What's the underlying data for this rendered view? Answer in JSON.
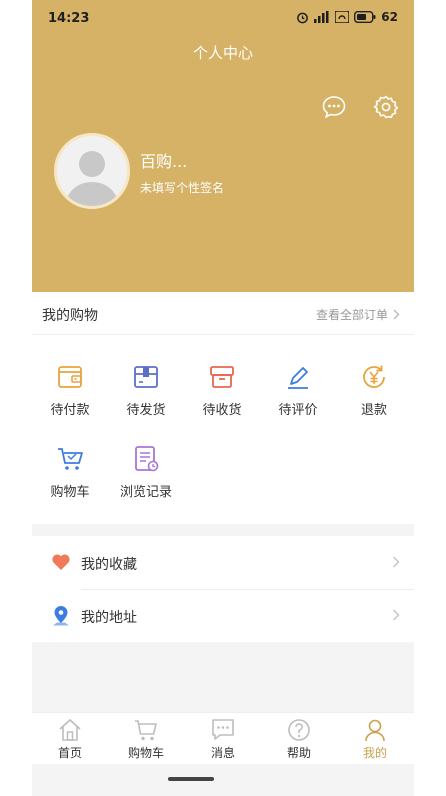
{
  "status_bar": {
    "time": "14:23",
    "battery": "62"
  },
  "header": {
    "title": "个人中心",
    "username": "百购...",
    "signature": "未填写个性签名"
  },
  "orders": {
    "title": "我的购物",
    "view_all": "查看全部订单",
    "items": [
      {
        "label": "待付款",
        "icon": "wallet-icon"
      },
      {
        "label": "待发货",
        "icon": "package-icon"
      },
      {
        "label": "待收货",
        "icon": "box-icon"
      },
      {
        "label": "待评价",
        "icon": "pen-icon"
      },
      {
        "label": "退款",
        "icon": "refund-icon"
      },
      {
        "label": "购物车",
        "icon": "cart-icon"
      },
      {
        "label": "浏览记录",
        "icon": "history-icon"
      }
    ]
  },
  "menu": [
    {
      "label": "我的收藏",
      "icon": "heart-icon"
    },
    {
      "label": "我的地址",
      "icon": "location-icon"
    }
  ],
  "tabbar": {
    "active": "我的",
    "items": [
      {
        "label": "首页",
        "icon": "home-icon"
      },
      {
        "label": "购物车",
        "icon": "cart-icon"
      },
      {
        "label": "消息",
        "icon": "message-icon"
      },
      {
        "label": "帮助",
        "icon": "help-icon"
      },
      {
        "label": "我的",
        "icon": "user-icon"
      }
    ]
  },
  "colors": {
    "header_bg": "#d5b266",
    "accent": "#c9a24b",
    "order_icon_colors": [
      "#e9a23b",
      "#5b6fc9",
      "#e8674f",
      "#3e7de0",
      "#e9a23b",
      "#3e7de0",
      "#a875d6"
    ]
  }
}
